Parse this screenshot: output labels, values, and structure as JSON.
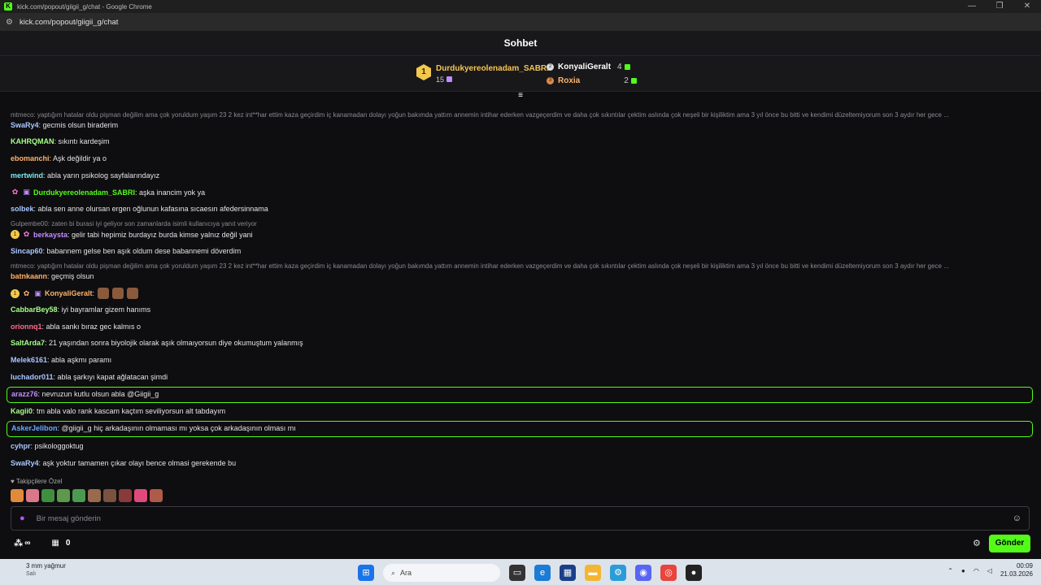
{
  "browser": {
    "window_title": "kick.com/popout/giigii_g/chat - Google Chrome",
    "url": "kick.com/popout/giigii_g/chat"
  },
  "chat": {
    "title": "Sohbet",
    "leaderboard": {
      "first": {
        "rank": "1",
        "name": "Durdukyereolenadam_SABRI",
        "count": "15"
      },
      "second": {
        "name": "KonyaliGeralt",
        "count": "4"
      },
      "third": {
        "name": "Roxia",
        "count": "2"
      }
    },
    "messages": [
      {
        "reply": "mtmeco: yaptığım hatalar oldu pişman değilim ama çok yoruldum yaşım 23 2 kez int**har ettim kaza geçirdim iç kanamadan dolayı yoğun bakımda yattım annemin intihar ederken vazgeçerdim ve daha çok sıkıntılar çektim aslında çok neşeli bir kişiliktim ama 3 yıl önce bu bitti ve kendimi düzeltemiyorum son 3 aydır her gece ...",
        "user": "SwaRy4",
        "text": ": gecmis olsun biraderim",
        "color": "#a9c7ff"
      },
      {
        "user": "KAHRQMAN",
        "text": ": sıkıntı kardeşim",
        "color": "#a6ff8a"
      },
      {
        "user": "ebomanchi",
        "text": ": Aşk değildir ya o",
        "color": "#ffb36b"
      },
      {
        "user": "mertwind",
        "text": ": abla yarın psikolog sayfalarındayız",
        "color": "#7ee8e8"
      },
      {
        "user": "Durdukyereolenadam_SABRI",
        "text": ": aşka inancim yok ya",
        "color": "#53fc18"
      },
      {
        "user": "solbek",
        "text": ": abla sen anne olursan ergen oğlunun kafasına sıcaesın afedersinnama",
        "color": "#a9c7ff"
      },
      {
        "reply": "Gulpembe00: zaten bi burasi iyi geliyor son zamanlarda isimli kullanıcıya yanıt veriyor",
        "user": "berkaysta",
        "text": ": gelir tabi hepimiz burdayız burda kimse yalnız değil yani",
        "color": "#c28cff"
      },
      {
        "user": "Sincap60",
        "text": ": babannem gelse ben aşık oldum dese babannemi döverdim",
        "color": "#a9c7ff"
      },
      {
        "reply": "mtmeco: yaptığım hatalar oldu pişman değilim ama çok yoruldum yaşım 23 2 kez int**har ettim kaza geçirdim iç kanamadan dolayı yoğun bakımda yattım annemin intihar ederken vazgeçerdim ve daha çok sıkıntılar çektim aslında çok neşeli bir kişiliktim ama 3 yıl önce bu bitti ve kendimi düzeltemiyorum son 3 aydır her gece ...",
        "user": "batnkaann",
        "text": ": geçmiş olsun",
        "color": "#ffb36b"
      },
      {
        "user": "KonyaliGeralt",
        "text": ":",
        "color": "#ffb36b"
      },
      {
        "user": "CabbarBey58",
        "text": ": iyi bayramlar gizem hanıms",
        "color": "#a6ff8a"
      },
      {
        "user": "orionnq1",
        "text": ": abla sankı bıraz gec kalmıs o",
        "color": "#ff6b8a"
      },
      {
        "user": "SaltArda7",
        "text": ": 21 yaşından sonra biyolojik olarak aşık olmaıyorsun diye okumuştum yalanmış",
        "color": "#a6ff8a"
      },
      {
        "user": "Melek6161",
        "text": ": abla aşkmı paramı",
        "color": "#a9c7ff"
      },
      {
        "user": "luchador011",
        "text": ": abla şarkıyı kapat ağlatacan şimdi",
        "color": "#a9c7ff"
      },
      {
        "user": "arazz76",
        "text": ": nevruzun kutlu olsun abla @Giigii_g",
        "color": "#c28cff"
      },
      {
        "user": "Kagii0",
        "text": ": tm abla valo rank kascam kaçtım seviliyorsun alt tabdayım",
        "color": "#a6ff8a"
      },
      {
        "user": "AskerJelibon",
        "text": ": @giigii_g hiç arkadaşının olmaması mı yoksa çok arkadaşının olması mı",
        "color": "#6aa8ff"
      },
      {
        "user": "cyhpr",
        "text": ": psikologgoktug",
        "color": "#a9c7ff"
      },
      {
        "user": "SwaRy4",
        "text": ": aşk yoktur tamamen çıkar olayı bence olmasi gerekende bu",
        "color": "#a9c7ff"
      }
    ],
    "followers_only": "Takipçilere Özel",
    "input_placeholder": "Bir mesaj gönderin",
    "infinity": "∞",
    "store_count": "0",
    "send_label": "Gönder"
  },
  "taskbar": {
    "weather_temp": "3 mm yağmur",
    "weather_day": "Salı",
    "search": "Ara",
    "time": "00:09",
    "date": "21.03.2026"
  }
}
